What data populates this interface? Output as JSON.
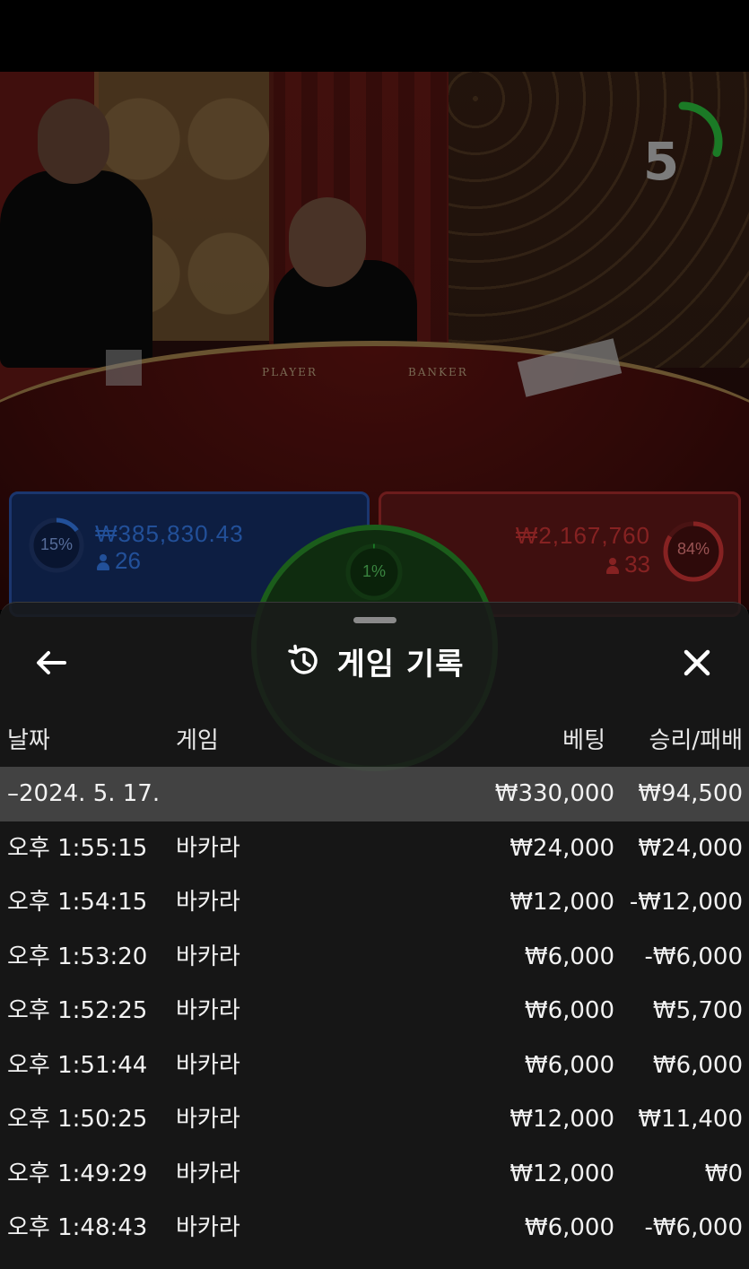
{
  "live": {
    "timer": "5",
    "felt_player": "PLAYER",
    "felt_banker": "BANKER",
    "player_bet": {
      "amount": "₩385,830.43",
      "players": "26",
      "percent": "15%",
      "ratio": 0.15,
      "color": "#3a86ff"
    },
    "banker_bet": {
      "amount": "₩2,167,760",
      "players": "33",
      "percent": "84%",
      "ratio": 0.84,
      "color": "#e03a3a"
    },
    "tie_bet": {
      "percent": "1%",
      "ratio": 0.01,
      "color": "#2ecc40"
    },
    "timer_ratio": 0.3
  },
  "sheet": {
    "title": "게임 기록",
    "back_icon": "arrow-left-icon",
    "history_icon": "history-icon",
    "close_icon": "close-icon",
    "columns": {
      "date": "날짜",
      "game": "게임",
      "bet": "베팅",
      "result": "승리/패배"
    },
    "group": {
      "date": "–2024. 5. 17.",
      "bet": "₩330,000",
      "result": "₩94,500"
    },
    "rows": [
      {
        "time": "오후 1:55:15",
        "game": "바카라",
        "bet": "₩24,000",
        "result": "₩24,000"
      },
      {
        "time": "오후 1:54:15",
        "game": "바카라",
        "bet": "₩12,000",
        "result": "-₩12,000"
      },
      {
        "time": "오후 1:53:20",
        "game": "바카라",
        "bet": "₩6,000",
        "result": "-₩6,000"
      },
      {
        "time": "오후 1:52:25",
        "game": "바카라",
        "bet": "₩6,000",
        "result": "₩5,700"
      },
      {
        "time": "오후 1:51:44",
        "game": "바카라",
        "bet": "₩6,000",
        "result": "₩6,000"
      },
      {
        "time": "오후 1:50:25",
        "game": "바카라",
        "bet": "₩12,000",
        "result": "₩11,400"
      },
      {
        "time": "오후 1:49:29",
        "game": "바카라",
        "bet": "₩12,000",
        "result": "₩0"
      },
      {
        "time": "오후 1:48:43",
        "game": "바카라",
        "bet": "₩6,000",
        "result": "-₩6,000"
      }
    ]
  }
}
